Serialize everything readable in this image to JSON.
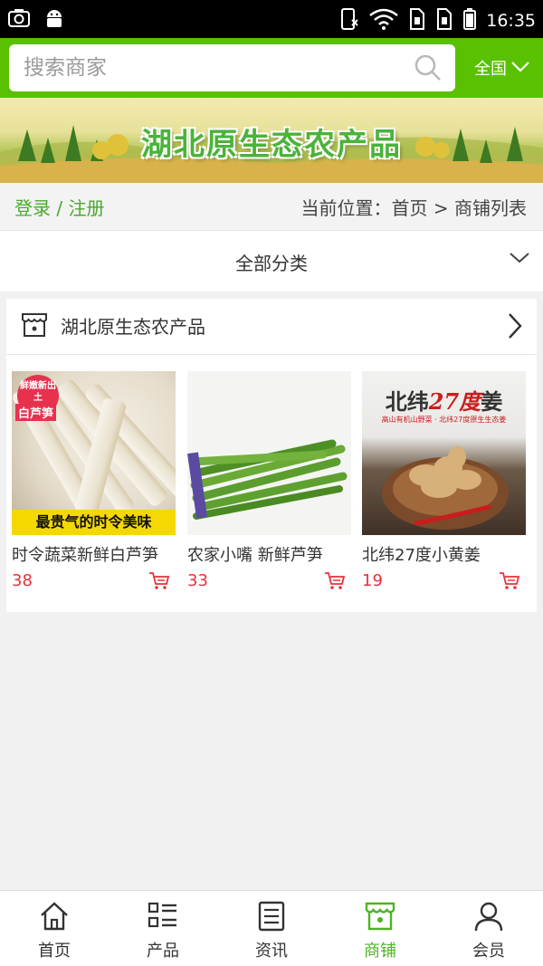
{
  "status_bar": {
    "time": "16:35"
  },
  "search": {
    "placeholder": "搜索商家",
    "region": "全国"
  },
  "banner": {
    "title": "湖北原生态农产品"
  },
  "breadcrumb": {
    "login": "登录",
    "separator": " / ",
    "register": "注册",
    "location": "当前位置：首页 > 商铺列表"
  },
  "category": {
    "label": "全部分类"
  },
  "shop": {
    "name": "湖北原生态农产品",
    "products": [
      {
        "title": "时令蔬菜新鲜白芦笋",
        "price": "38",
        "image_tag": "鲜嫩新出土",
        "image_tag2": "白芦笋",
        "image_slogan": "最贵气的时令美味"
      },
      {
        "title": "农家小嘴 新鲜芦笋",
        "price": "33"
      },
      {
        "title": "北纬27度小黄姜",
        "price": "19",
        "image_headline_a": "北纬",
        "image_headline_b": "27度",
        "image_headline_c": "姜",
        "image_subline": "高山有机山野菜 · 北纬27度原生生态姜"
      }
    ]
  },
  "tabs": [
    {
      "label": "首页",
      "icon": "home-icon",
      "active": false
    },
    {
      "label": "产品",
      "icon": "list-icon",
      "active": false
    },
    {
      "label": "资讯",
      "icon": "news-icon",
      "active": false
    },
    {
      "label": "商铺",
      "icon": "store-icon",
      "active": true
    },
    {
      "label": "会员",
      "icon": "user-icon",
      "active": false
    }
  ],
  "colors": {
    "brand_green": "#59c100",
    "price_red": "#e8313a",
    "active_tab": "#4fb325"
  }
}
